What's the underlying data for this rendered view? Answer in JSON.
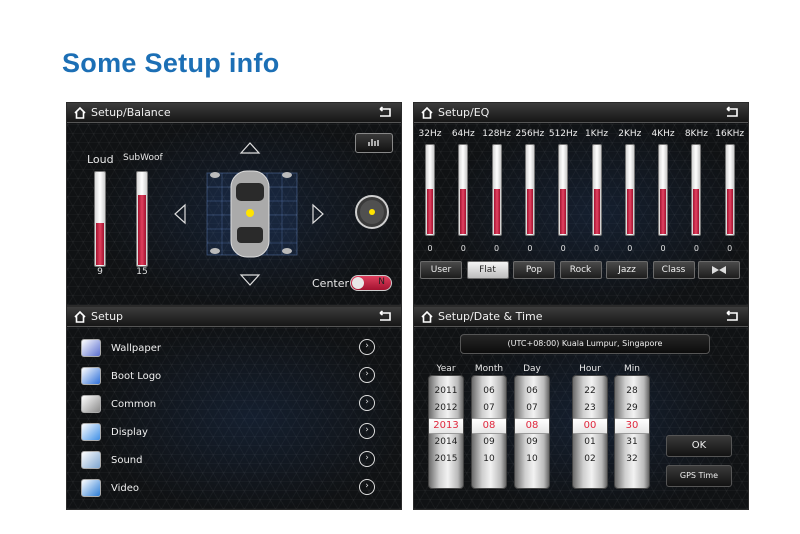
{
  "heading": "Some Setup info",
  "balance": {
    "title": "Setup/Balance",
    "loud_label": "Loud",
    "subwoof_label": "SubWoof",
    "loud_value": "9",
    "subwoof_value": "15",
    "loud_level": 0.45,
    "subwoof_level": 0.75,
    "center_label": "Center",
    "center_toggle": "N"
  },
  "eq": {
    "title": "Setup/EQ",
    "bands": [
      {
        "freq": "32Hz",
        "value": "0"
      },
      {
        "freq": "64Hz",
        "value": "0"
      },
      {
        "freq": "128Hz",
        "value": "0"
      },
      {
        "freq": "256Hz",
        "value": "0"
      },
      {
        "freq": "512Hz",
        "value": "0"
      },
      {
        "freq": "1KHz",
        "value": "0"
      },
      {
        "freq": "2KHz",
        "value": "0"
      },
      {
        "freq": "4KHz",
        "value": "0"
      },
      {
        "freq": "8KHz",
        "value": "0"
      },
      {
        "freq": "16KHz",
        "value": "0"
      }
    ],
    "band_level": 0.5,
    "presets": [
      "User",
      "Flat",
      "Pop",
      "Rock",
      "Jazz",
      "Class"
    ],
    "active_preset": "Flat"
  },
  "setup": {
    "title": "Setup",
    "items": [
      {
        "label": "Wallpaper",
        "icon": "wallpaper-icon",
        "color": "#5a6fd0"
      },
      {
        "label": "Boot Logo",
        "icon": "boot-logo-icon",
        "color": "#2d6fd8"
      },
      {
        "label": "Common",
        "icon": "common-icon",
        "color": "#8a8a8a"
      },
      {
        "label": "Display",
        "icon": "display-icon",
        "color": "#3f8fe6"
      },
      {
        "label": "Sound",
        "icon": "sound-icon",
        "color": "#7da4cf"
      },
      {
        "label": "Video",
        "icon": "video-icon",
        "color": "#2c7dd6"
      }
    ]
  },
  "datetime": {
    "title": "Setup/Date & Time",
    "timezone": "(UTC+08:00) Kuala Lumpur, Singapore",
    "columns": [
      {
        "label": "Year",
        "values": [
          "2011",
          "2012",
          "2013",
          "2014",
          "2015"
        ]
      },
      {
        "label": "Month",
        "values": [
          "06",
          "07",
          "08",
          "09",
          "10"
        ]
      },
      {
        "label": "Day",
        "values": [
          "06",
          "07",
          "08",
          "09",
          "10"
        ]
      },
      {
        "label": "Hour",
        "values": [
          "22",
          "23",
          "00",
          "01",
          "02"
        ]
      },
      {
        "label": "Min",
        "values": [
          "28",
          "29",
          "30",
          "31",
          "32"
        ]
      }
    ],
    "ok_label": "OK",
    "gps_label": "GPS Time"
  },
  "colors": {
    "accent": "#1c6fb5",
    "slider_red": "#d0304e",
    "selected_text": "#e0283e"
  }
}
